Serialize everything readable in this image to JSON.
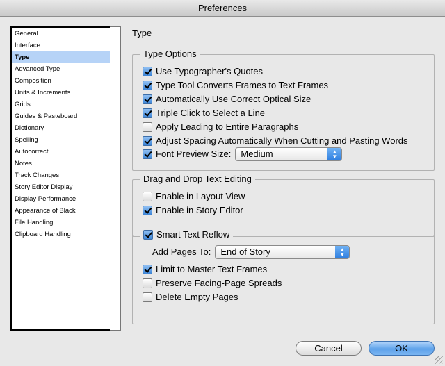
{
  "window": {
    "title": "Preferences"
  },
  "sidebar": {
    "items": [
      {
        "label": "General",
        "selected": false
      },
      {
        "label": "Interface",
        "selected": false
      },
      {
        "label": "Type",
        "selected": true
      },
      {
        "label": "Advanced Type",
        "selected": false
      },
      {
        "label": "Composition",
        "selected": false
      },
      {
        "label": "Units & Increments",
        "selected": false
      },
      {
        "label": "Grids",
        "selected": false
      },
      {
        "label": "Guides & Pasteboard",
        "selected": false
      },
      {
        "label": "Dictionary",
        "selected": false
      },
      {
        "label": "Spelling",
        "selected": false
      },
      {
        "label": "Autocorrect",
        "selected": false
      },
      {
        "label": "Notes",
        "selected": false
      },
      {
        "label": "Track Changes",
        "selected": false
      },
      {
        "label": "Story Editor Display",
        "selected": false
      },
      {
        "label": "Display Performance",
        "selected": false
      },
      {
        "label": "Appearance of Black",
        "selected": false
      },
      {
        "label": "File Handling",
        "selected": false
      },
      {
        "label": "Clipboard Handling",
        "selected": false
      }
    ]
  },
  "panel": {
    "title": "Type",
    "type_options": {
      "legend": "Type Options",
      "options": [
        {
          "label": "Use Typographer's Quotes",
          "checked": true
        },
        {
          "label": "Type Tool Converts Frames to Text Frames",
          "checked": true
        },
        {
          "label": "Automatically Use Correct Optical Size",
          "checked": true
        },
        {
          "label": "Triple Click to Select a Line",
          "checked": true
        },
        {
          "label": "Apply Leading to Entire Paragraphs",
          "checked": false
        },
        {
          "label": "Adjust Spacing Automatically When Cutting and Pasting Words",
          "checked": true
        }
      ],
      "font_preview": {
        "label": "Font Preview Size:",
        "checked": true,
        "value": "Medium"
      }
    },
    "drag_drop": {
      "legend": "Drag and Drop Text Editing",
      "options": [
        {
          "label": "Enable in Layout View",
          "checked": false
        },
        {
          "label": "Enable in Story Editor",
          "checked": true
        }
      ]
    },
    "smart_reflow": {
      "legend": "Smart Text Reflow",
      "checked": true,
      "add_pages_label": "Add Pages To:",
      "add_pages_value": "End of Story",
      "options": [
        {
          "label": "Limit to Master Text Frames",
          "checked": true
        },
        {
          "label": "Preserve Facing-Page Spreads",
          "checked": false
        },
        {
          "label": "Delete Empty Pages",
          "checked": false
        }
      ]
    }
  },
  "buttons": {
    "cancel": "Cancel",
    "ok": "OK"
  },
  "icons": {
    "popup": "up-down-arrows-icon",
    "grip": "resize-grip-icon"
  },
  "colors": {
    "selection": "#b6d3f7",
    "accent": "#3d86d8"
  }
}
